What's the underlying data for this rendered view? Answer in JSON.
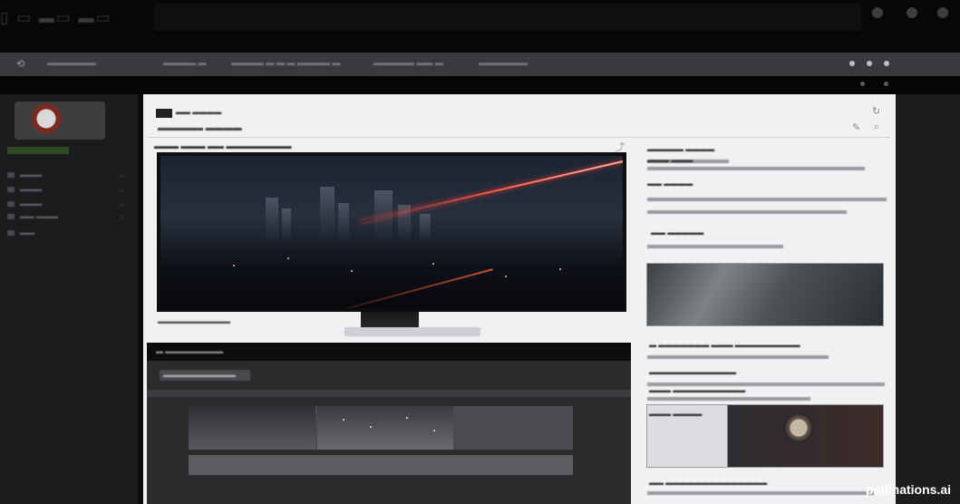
{
  "window": {
    "title": "▯ ▭ ▬▭ ▬▭",
    "control_icons": [
      "minimize-icon",
      "restore-icon",
      "close-icon"
    ]
  },
  "toolbar": {
    "back_icon": "back-arrow-icon",
    "segments": [
      "▬▬▬▬▬▬",
      "▬▬▬▬ ▬",
      "▬▬▬▬ ▬ ▬ ▬ ▬▬▬▬ ▬",
      "▬▬▬▬▬ ▬▬ ▬",
      "▬▬▬▬▬▬"
    ],
    "right_icons": [
      "menu-dot-icon",
      "settings-icon",
      "profile-icon"
    ]
  },
  "sidebar": {
    "items": [
      {
        "label": "▬▬▬"
      },
      {
        "label": "▬▬▬"
      },
      {
        "label": "▬▬▬"
      },
      {
        "label": "▬▬ ▬▬▬"
      },
      {
        "label": "▬▬"
      }
    ]
  },
  "panel": {
    "logo_text": "▬▬ ▬▬▬▬",
    "breadcrumb": "▬▬▬▬▬ ▬▬▬▬",
    "main_title": "▬▬▬ ▬▬▬ ▬▬ ▬▬▬▬▬▬▬▬",
    "caption": "▬▬▬▬▬▬▬▬▬▬",
    "dark_card": {
      "heading": "▬ ▬▬▬▬▬▬▬▬",
      "sub_label": "▬▬▬▬▬▬▬▬▬▬"
    },
    "right_column": {
      "blocks": [
        {
          "heading": "▬▬▬▬▬ ▬▬▬▬"
        },
        {
          "heading": "▬▬▬ ▬▬▬"
        },
        {
          "heading": "▬▬ ▬▬▬▬"
        },
        {
          "heading": "▬▬ ▬▬▬▬▬"
        },
        {
          "heading": "▬ ▬▬▬▬▬▬▬ ▬▬▬ ▬▬▬▬▬▬▬▬▬"
        },
        {
          "heading": "▬▬▬▬▬▬▬▬▬▬▬▬"
        },
        {
          "heading": "▬▬▬ ▬▬▬▬▬▬▬▬▬▬"
        },
        {
          "heading": "▬▬▬ ▬▬▬▬"
        },
        {
          "heading": "▬▬ ▬▬▬▬▬▬▬▬▬▬▬▬▬▬"
        }
      ]
    }
  },
  "watermark": "pollinations.ai"
}
